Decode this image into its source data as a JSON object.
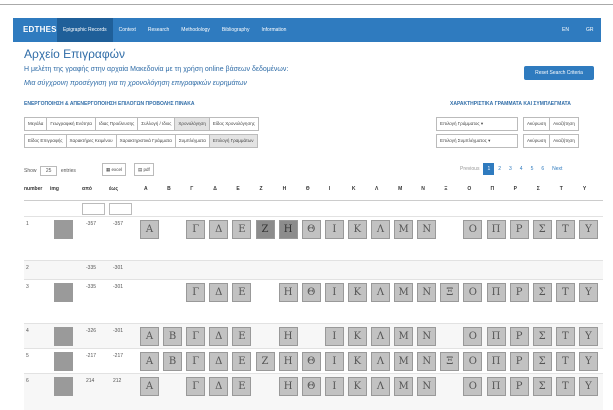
{
  "app": {
    "brand": "EDTHESS"
  },
  "nav": [
    {
      "label": "Epigraphic Records",
      "active": true
    },
    {
      "label": "Context",
      "active": false
    },
    {
      "label": "Research",
      "active": false
    },
    {
      "label": "Methodology",
      "active": false
    },
    {
      "label": "Bibliography",
      "active": false
    },
    {
      "label": "Information",
      "active": false
    }
  ],
  "lang": {
    "en": "EN",
    "gr": "GR"
  },
  "header": {
    "title": "Αρχείο Επιγραφών",
    "sub1": "Η μελέτη της γραφής στην αρχαία Μακεδονία με τη χρήση online βάσεων δεδομένων:",
    "sub2": "Μια σύγχρονη προσέγγιση για τη χρονολόγηση επιγραφικών ευρημάτων",
    "reset": "Reset Search Criteria"
  },
  "sections": {
    "left": "ΕΝΕΡΓΟΠΟΙΗΣΗ & ΑΠΕΝΕΡΓΟΠΟΙΗΣΗ ΕΠΙΛΟΓΩΝ ΠΡΟΒΟΛΗΣ ΠΙΝΑΚΑ",
    "right": "ΧΑΡΑΚΤΗΡΙΣΤΙΚΑ ΓΡΑΜΜΑΤΑ ΚΑΙ ΣΥΜΠΛΕΓΜΑΤΑ"
  },
  "toggles_row1": [
    {
      "label": "Μεγάλα",
      "on": false
    },
    {
      "label": "Γεωγραφική Ενότητα",
      "on": false
    },
    {
      "label": "Ιδιας Προέλευσης",
      "on": false
    },
    {
      "label": "Συλλογή / Ιδιος",
      "on": false
    },
    {
      "label": "Χρονολόγηση",
      "on": true
    },
    {
      "label": "Είδος Χρονολόγησης",
      "on": false
    }
  ],
  "toggles_row2": [
    {
      "label": "Είδος Επιγραφής",
      "on": false
    },
    {
      "label": "Χαρακτήρες Κειμένου",
      "on": false
    },
    {
      "label": "Χαρακτηριστικά Γράμματα",
      "on": false
    },
    {
      "label": "Συμπλέγματα",
      "on": false
    },
    {
      "label": "Επιλογή Γραμμάτων",
      "on": true
    }
  ],
  "right_row1": {
    "select": "Επιλογή Γράμματος ▾",
    "clear": "Ακύρωση",
    "reverse": "Αναζήτηση"
  },
  "right_row2": {
    "select": "Επιλογή Συμπλέγματος ▾",
    "clear": "Ακύρωση",
    "reverse": "Αναζήτηση"
  },
  "controls": {
    "show": "Show",
    "count": "25",
    "entries": "entries",
    "excel": "excel",
    "pdf": "pdf"
  },
  "pager": {
    "prev": "Previous",
    "pages": [
      "1",
      "2",
      "3",
      "4",
      "5",
      "6"
    ],
    "next": "Next",
    "current": "1"
  },
  "columns": [
    "number",
    "img",
    "από",
    "έως",
    "Α",
    "Β",
    "Γ",
    "Δ",
    "Ε",
    "Ζ",
    "Η",
    "Θ",
    "Ι",
    "Κ",
    "Λ",
    "Μ",
    "Ν",
    "Ξ",
    "Ο",
    "Π",
    "Ρ",
    "Σ",
    "Τ",
    "Υ"
  ],
  "rows": [
    {
      "number": "1",
      "from": "-357",
      "to": "-357",
      "img": true,
      "letters": "Α,,Γ,Δ,Ε,Ζ,Η,Θ,Ι,Κ,Λ,Μ,Ν,,Ο,Π,Ρ,Σ,Τ,Υ"
    },
    {
      "number": "2",
      "from": "-335",
      "to": "-301",
      "img": false,
      "letters": ",,,,,,,,,,,,,,,,,,,"
    },
    {
      "number": "3",
      "from": "-335",
      "to": "-301",
      "img": true,
      "letters": ",,Γ,Δ,Ε,,Η,Θ,Ι,Κ,Λ,Μ,Ν,Ξ,Ο,Π,Ρ,Σ,Τ,Υ"
    },
    {
      "number": "4",
      "from": "-326",
      "to": "-301",
      "img": true,
      "letters": "Α,Β,Γ,Δ,Ε,,Η,,Ι,Κ,Λ,Μ,Ν,,Ο,Π,Ρ,Σ,Τ,Υ"
    },
    {
      "number": "5",
      "from": "-217",
      "to": "-217",
      "img": true,
      "letters": "Α,Β,Γ,Δ,Ε,Ζ,Η,Θ,Ι,Κ,Λ,Μ,Ν,Ξ,Ο,Π,Ρ,Σ,Τ,Υ"
    },
    {
      "number": "6",
      "from": "214",
      "to": "212",
      "img": true,
      "letters": "Α,,Γ,Δ,Ε,,Η,Θ,Ι,Κ,Λ,Μ,Ν,,Ο,Π,Ρ,Σ,Τ,Υ"
    }
  ],
  "colors": {
    "primary": "#2f7bbf",
    "title": "#2f6ca7"
  }
}
